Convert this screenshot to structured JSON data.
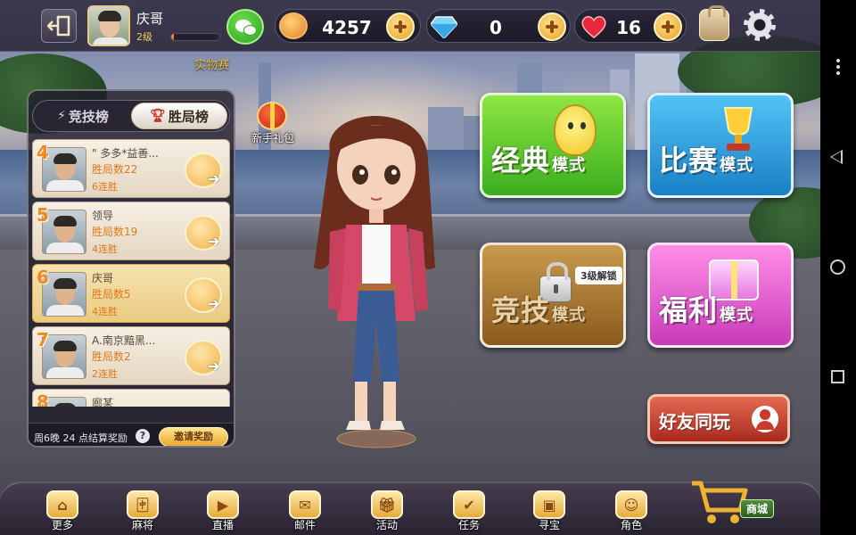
{
  "topbar": {
    "user_name": "庆哥",
    "user_level": "2级",
    "level_progress": 0.05,
    "gold": "4257",
    "diamonds": "0",
    "hearts": "16",
    "match_label": "实物赛"
  },
  "leaderboard": {
    "tab_competition": "竞技榜",
    "tab_wins": "胜局榜",
    "active_tab": "胜局榜",
    "rows": [
      {
        "rank": "4",
        "name": "\" 多多*益善...",
        "wins": "胜局数22",
        "streak": "6连胜",
        "highlight": false
      },
      {
        "rank": "5",
        "name": "领导",
        "wins": "胜局数19",
        "streak": "4连胜",
        "highlight": false
      },
      {
        "rank": "6",
        "name": "庆哥",
        "wins": "胜局数5",
        "streak": "4连胜",
        "highlight": true
      },
      {
        "rank": "7",
        "name": "A.南京黯黑...",
        "wins": "胜局数2",
        "streak": "2连胜",
        "highlight": false
      },
      {
        "rank": "8",
        "name": "廊某",
        "wins": "",
        "streak": "",
        "highlight": false
      }
    ],
    "footer_note": "周6晚 24 点结算奖励",
    "help": "?",
    "invite_button": "邀请奖励"
  },
  "newbie_gift": "新手礼包",
  "modes": {
    "classic": {
      "main": "经典",
      "sub": "模式"
    },
    "match": {
      "main": "比赛",
      "sub": "模式"
    },
    "compete": {
      "main": "竞技",
      "sub": "模式",
      "unlock": "3级解锁"
    },
    "welfare": {
      "main": "福利",
      "sub": "模式"
    }
  },
  "friends_button": "好友同玩",
  "bottom_nav": {
    "more": "更多",
    "mahjong": "麻将",
    "live": "直播",
    "mail": "邮件",
    "events": "活动",
    "tasks": "任务",
    "treasure": "寻宝",
    "character": "角色",
    "shop": "商城"
  },
  "icons": {
    "exit": "exit-icon",
    "wechat": "wechat-icon",
    "gold": "gold-coin-icon",
    "diamond": "diamond-icon",
    "heart": "heart-icon",
    "bag": "backpack-icon",
    "settings": "gear-icon",
    "cart": "cart-icon",
    "lock": "lock-icon"
  },
  "colors": {
    "accent_orange": "#e9a126",
    "classic_green": "#3aae1e",
    "match_blue": "#1a7fc6",
    "compete_brown": "#8a5a1e",
    "welfare_pink": "#c83ab8",
    "friends_red": "#a82a1e"
  }
}
